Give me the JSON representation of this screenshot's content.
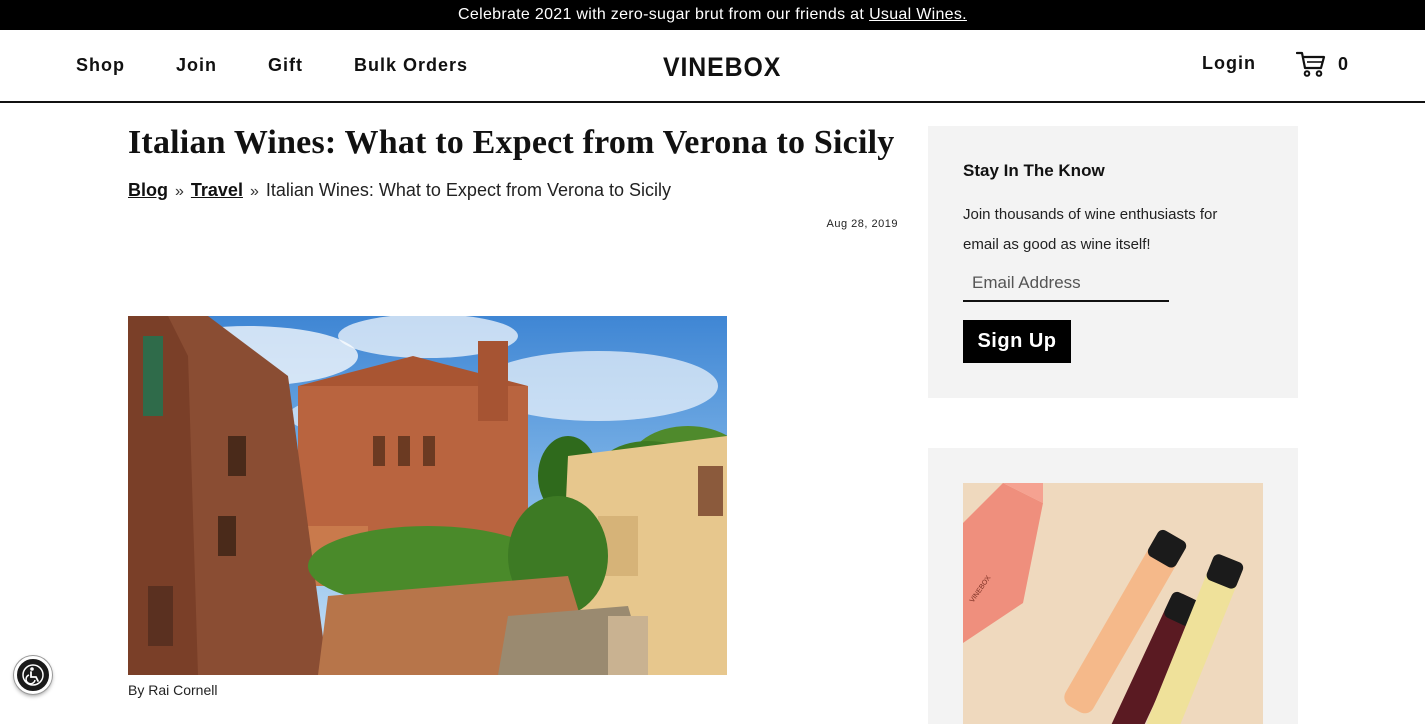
{
  "promo": {
    "text": "Celebrate 2021 with zero-sugar brut from our friends at",
    "link": "Usual Wines."
  },
  "header": {
    "nav": [
      "Shop",
      "Join",
      "Gift",
      "Bulk Orders"
    ],
    "logo": "VINEBOX",
    "login": "Login",
    "cart_count": "0"
  },
  "article": {
    "title": "Italian Wines: What to Expect from Verona to Sicily",
    "breadcrumb": {
      "blog": "Blog",
      "separator": "»",
      "travel": "Travel",
      "current": "Italian Wines: What to Expect from Verona to Sicily"
    },
    "date": "Aug 28, 2019",
    "byline": "By Rai Cornell"
  },
  "sidebar": {
    "title": "Stay In The Know",
    "text": "Join thousands of wine enthusiasts for email as good as wine itself!",
    "email_placeholder": "Email Address",
    "signup_label": "Sign Up"
  },
  "promo_image": {
    "box_label": "VINEBOX"
  },
  "colors": {
    "black": "#000000",
    "sidebar_bg": "#f3f3f3",
    "text": "#111111"
  }
}
